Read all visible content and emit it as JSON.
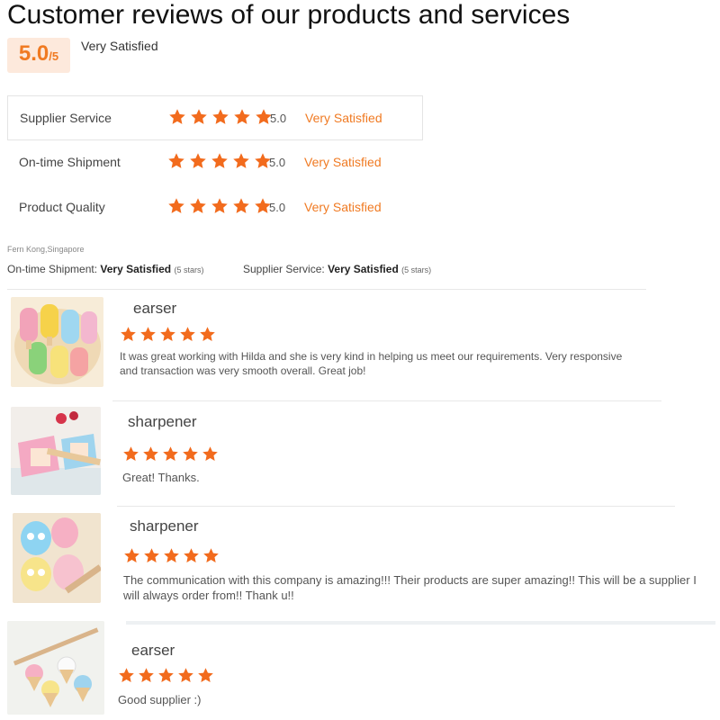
{
  "page_title": "Customer reviews of our products and services",
  "overall": {
    "score": "5.0",
    "out_of": "/5",
    "label": "Very Satisfied"
  },
  "ratings": [
    {
      "label": "Supplier Service",
      "value": "5.0",
      "text": "Very Satisfied",
      "stars": 5
    },
    {
      "label": "On-time Shipment",
      "value": "5.0",
      "text": "Very Satisfied",
      "stars": 5
    },
    {
      "label": "Product Quality",
      "value": "5.0",
      "text": "Very Satisfied",
      "stars": 5
    }
  ],
  "reviewer": "Fern Kong,Singapore",
  "summary": {
    "shipment_label": "On-time Shipment:",
    "shipment_value": "Very Satisfied",
    "shipment_count": "(5 stars)",
    "service_label": "Supplier Service:",
    "service_value": "Very Satisfied",
    "service_count": "(5 stars)"
  },
  "reviews": [
    {
      "product": "earser",
      "stars": 5,
      "text": "It was great working with Hilda and she is very kind in helping us meet our requirements. Very responsive and transaction was very smooth overall. Great job!"
    },
    {
      "product": "sharpener",
      "stars": 5,
      "text": "Great! Thanks."
    },
    {
      "product": "sharpener",
      "stars": 5,
      "text": "The communication with this company is amazing!!! Their products are super amazing!! This will be a supplier I will always order from!! Thank u!!"
    },
    {
      "product": "earser",
      "stars": 5,
      "text": "Good supplier :)"
    }
  ],
  "colors": {
    "accent": "#f07a22",
    "score_bg": "#fde9dc",
    "star": "#f26b1d"
  },
  "icons": {
    "star": "star-icon"
  }
}
